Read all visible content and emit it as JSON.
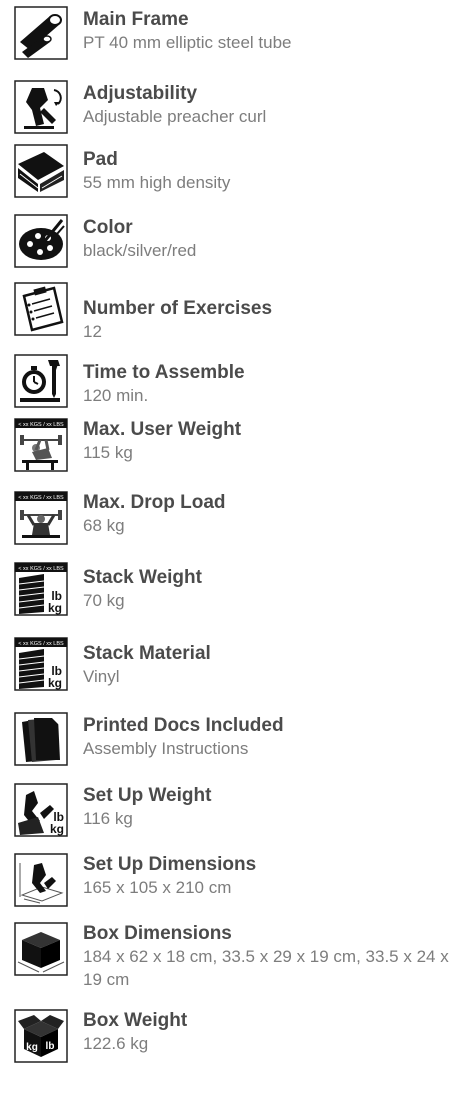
{
  "specs": [
    {
      "icon": "steel-tube-icon",
      "label": "Main Frame",
      "value": "PT 40 mm elliptic steel tube"
    },
    {
      "icon": "preacher-curl-icon",
      "label": "Adjustability",
      "value": "Adjustable preacher curl"
    },
    {
      "icon": "pad-icon",
      "label": "Pad",
      "value": "55 mm high density"
    },
    {
      "icon": "color-palette-icon",
      "label": "Color",
      "value": "black/silver/red"
    },
    {
      "icon": "clipboard-icon",
      "label": "Number of Exercises",
      "value": "12"
    },
    {
      "icon": "stopwatch-wrench-icon",
      "label": "Time to Assemble",
      "value": "120 min."
    },
    {
      "icon": "user-weight-icon",
      "label": "Max. User Weight",
      "value": "115 kg"
    },
    {
      "icon": "drop-load-icon",
      "label": "Max. Drop Load",
      "value": "68 kg"
    },
    {
      "icon": "weight-stack-icon",
      "label": "Stack Weight",
      "value": "70 kg"
    },
    {
      "icon": "weight-stack-icon",
      "label": "Stack Material",
      "value": "Vinyl"
    },
    {
      "icon": "documents-icon",
      "label": "Printed Docs Included",
      "value": "Assembly Instructions"
    },
    {
      "icon": "setup-weight-icon",
      "label": "Set Up Weight",
      "value": "116 kg"
    },
    {
      "icon": "setup-dimensions-icon",
      "label": "Set Up Dimensions",
      "value": "165 x 105 x 210 cm"
    },
    {
      "icon": "box-icon",
      "label": "Box Dimensions",
      "value": "184 x 62 x 18 cm, 33.5 x 29 x 19 cm, 33.5 x 24 x 19 cm"
    },
    {
      "icon": "box-weight-icon",
      "label": "Box Weight",
      "value": "122.6 kg"
    }
  ],
  "icon_text": {
    "load_tag": "< xx KGS / xx LBS",
    "lb": "lb",
    "kg": "kg"
  }
}
